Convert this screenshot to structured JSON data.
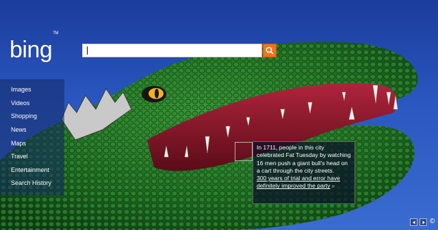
{
  "brand": {
    "logo_text": "bing",
    "trademark": "TM"
  },
  "search": {
    "value": "",
    "placeholder": ""
  },
  "nav": {
    "items": [
      {
        "label": "Images"
      },
      {
        "label": "Videos"
      },
      {
        "label": "Shopping"
      },
      {
        "label": "News"
      },
      {
        "label": "Maps"
      },
      {
        "label": "Travel"
      },
      {
        "label": "Entertainment"
      },
      {
        "label": "Search History"
      }
    ]
  },
  "caption": {
    "text": "In 1711, people in this city celebrated Fat Tuesday by watching 16 men push a giant bull's head on a cart through the city streets.",
    "link": "300 years of trial and error have definitely improved the party",
    "arrow": "»"
  },
  "controls": {
    "copyright": "©"
  },
  "colors": {
    "search_button": "#f0741e",
    "sky": "#2a57c0",
    "alligator": "#1f6b2a"
  }
}
